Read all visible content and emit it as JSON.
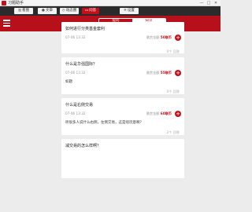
{
  "window": {
    "title": "习题助手",
    "minimize": "—",
    "maximize": "□",
    "close": "✕"
  },
  "toolbar": {
    "buttons": [
      {
        "label": "看图",
        "icon": "chart-icon"
      },
      {
        "label": "文章",
        "icon": "user-icon"
      },
      {
        "label": "动态圈",
        "icon": "clock-icon"
      },
      {
        "label": "问答",
        "icon": "chat-icon"
      },
      {
        "label": "设置",
        "icon": "gear-icon"
      }
    ]
  },
  "tabs": [
    {
      "label": "提问"
    },
    {
      "label": "知识"
    }
  ],
  "cards": [
    {
      "question": "如何进行分类基金套利",
      "date": "07-06 13:32",
      "reward_label": "悬赏金额",
      "reward": "50联币",
      "answer": "",
      "count": "0个  回答"
    },
    {
      "question": "什么是华强国际？",
      "date": "07-06 13:32",
      "reward_label": "悬赏金额",
      "reward": "55联币",
      "answer": "如题",
      "count": "0个  回答"
    },
    {
      "question": "什么是右侧交易",
      "date": "07-06 13:32",
      "reward_label": "悬赏金额",
      "reward": "60联币",
      "answer": "听很多人说什么右侧，左侧交易，这是啥玩意啊？",
      "count": "2个  回答"
    },
    {
      "question": "减交易的怎么样啊？",
      "date": "",
      "reward_label": "",
      "reward": "",
      "answer": "",
      "count": ""
    }
  ]
}
